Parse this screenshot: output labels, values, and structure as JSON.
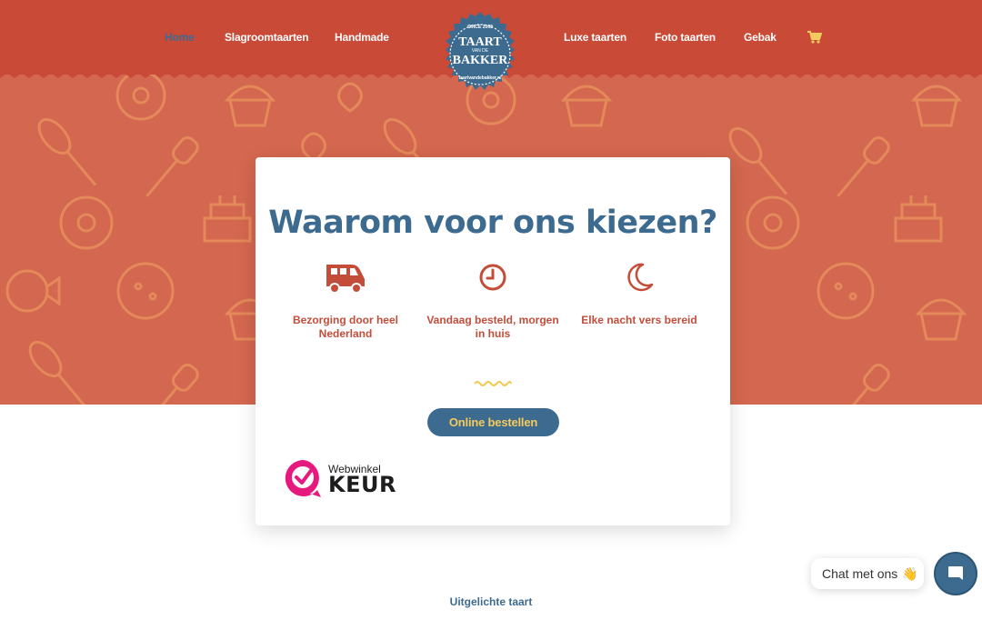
{
  "nav": {
    "left": [
      "Home",
      "Slagroomtaarten",
      "Handmade"
    ],
    "right": [
      "Luxe taarten",
      "Foto taarten",
      "Gebak"
    ]
  },
  "logo": {
    "top_text": "SINCE 2008",
    "line1": "TAART",
    "line2": "VAN DE",
    "line3": "BAKKER",
    "bottom_text": "taartvandebakker.nl"
  },
  "card": {
    "title": "Waarom voor ons kiezen?",
    "features": [
      {
        "icon": "van-icon",
        "label": "Bezorging door heel Nederland"
      },
      {
        "icon": "clock-icon",
        "label": "Vandaag besteld, morgen in huis"
      },
      {
        "icon": "moon-icon",
        "label": "Elke nacht vers bereid"
      }
    ],
    "button_label": "Online bestellen",
    "badge": {
      "top": "Webwinkel",
      "main": "KEUR"
    }
  },
  "featured_heading": "Uitgelichte taart",
  "chat": {
    "label": "Chat met ons",
    "emoji": "👋"
  },
  "colors": {
    "header": "#c94a37",
    "hero": "#d4674f",
    "primary_blue": "#3d6b8f",
    "accent_red": "#c44d3a",
    "button_text": "#f4c95d",
    "cart": "#f4c95d"
  }
}
